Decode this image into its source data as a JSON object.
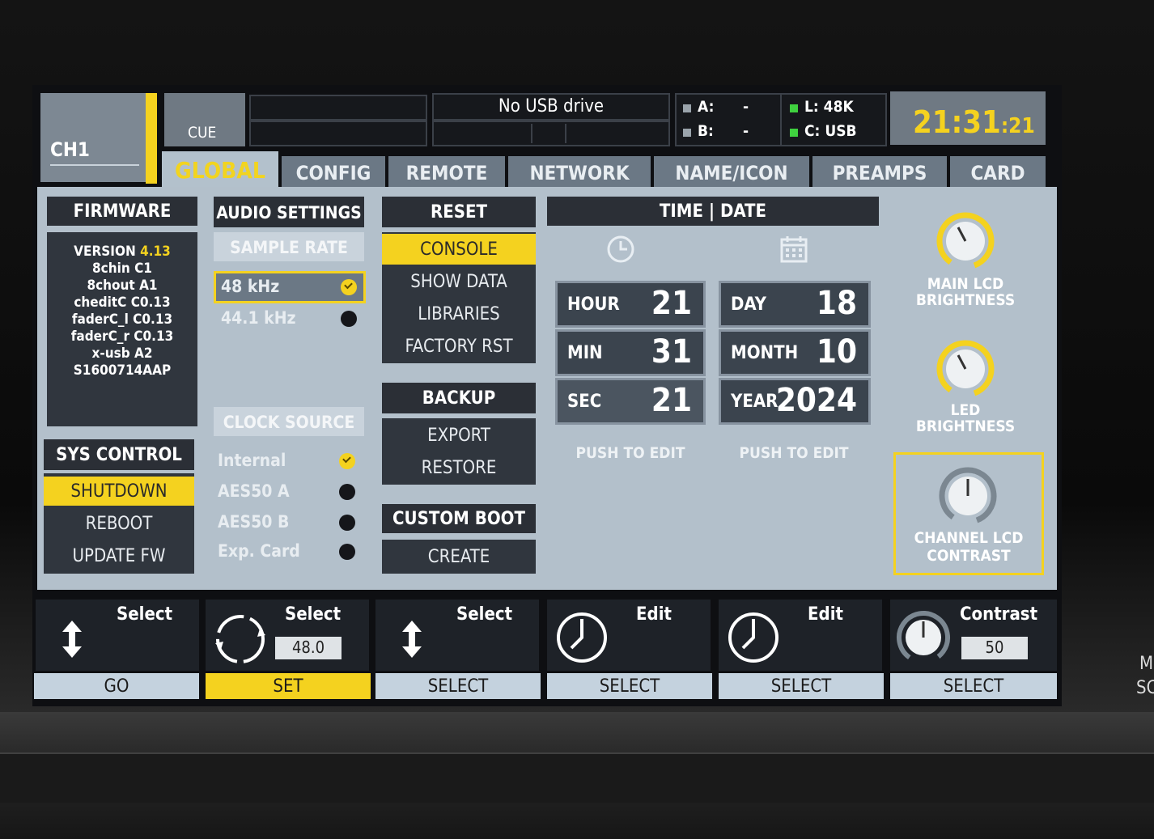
{
  "channel": {
    "name": "CH1",
    "cue_label": "CUE"
  },
  "status": {
    "usb": "No USB drive",
    "a_label": "A:",
    "a_value": "-",
    "b_label": "B:",
    "b_value": "-",
    "l_label": "L: 48K",
    "c_label": "C: USB",
    "time_main": "21:31",
    "time_sec": ":21"
  },
  "tabs": [
    "GLOBAL",
    "CONFIG",
    "REMOTE",
    "NETWORK",
    "NAME/ICON",
    "PREAMPS",
    "CARD"
  ],
  "active_tab": "GLOBAL",
  "firmware": {
    "title": "FIRMWARE",
    "version_label": "VERSION",
    "version_value": "4.13",
    "lines": [
      "8chin C1",
      "8chout A1",
      "cheditC C0.13",
      "faderC_l C0.13",
      "faderC_r C0.13",
      "x-usb A2",
      "S1600714AAP"
    ]
  },
  "sys_control": {
    "title": "SYS CONTROL",
    "items": [
      "SHUTDOWN",
      "REBOOT",
      "UPDATE FW"
    ],
    "selected": "SHUTDOWN"
  },
  "audio": {
    "title": "AUDIO SETTINGS",
    "sample_rate_label": "SAMPLE RATE",
    "sample_rates": [
      "48 kHz",
      "44.1 kHz"
    ],
    "sample_rate_selected": "48 kHz",
    "clock_label": "CLOCK SOURCE",
    "clock_sources": [
      "Internal",
      "AES50 A",
      "AES50 B",
      "Exp. Card"
    ],
    "clock_selected": "Internal"
  },
  "reset": {
    "title": "RESET",
    "items": [
      "CONSOLE",
      "SHOW DATA",
      "LIBRARIES",
      "FACTORY RST"
    ],
    "selected": "CONSOLE"
  },
  "backup": {
    "title": "BACKUP",
    "items": [
      "EXPORT",
      "RESTORE"
    ]
  },
  "custom_boot": {
    "title": "CUSTOM BOOT",
    "items": [
      "CREATE"
    ]
  },
  "time_date": {
    "title": "TIME | DATE",
    "hour_label": "HOUR",
    "hour": "21",
    "min_label": "MIN",
    "min": "31",
    "sec_label": "SEC",
    "sec": "21",
    "day_label": "DAY",
    "day": "18",
    "month_label": "MONTH",
    "month": "10",
    "year_label": "YEAR",
    "year": "2024",
    "push_time": "PUSH TO EDIT",
    "push_date": "PUSH TO EDIT"
  },
  "knobs": {
    "main_lcd": "MAIN LCD BRIGHTNESS",
    "led": "LED BRIGHTNESS",
    "channel_lcd": "CHANNEL LCD CONTRAST"
  },
  "encoders": [
    {
      "title": "Select",
      "button": "GO"
    },
    {
      "title": "Select",
      "value": "48.0",
      "button": "SET"
    },
    {
      "title": "Select",
      "button": "SELECT"
    },
    {
      "title": "Edit",
      "button": "SELECT"
    },
    {
      "title": "Edit",
      "button": "SELECT"
    },
    {
      "title": "Contrast",
      "value": "50",
      "button": "SELECT"
    }
  ],
  "colors": {
    "accent": "#f4d21f",
    "panel": "#b3c0cb",
    "dark": "#2b2f36"
  }
}
